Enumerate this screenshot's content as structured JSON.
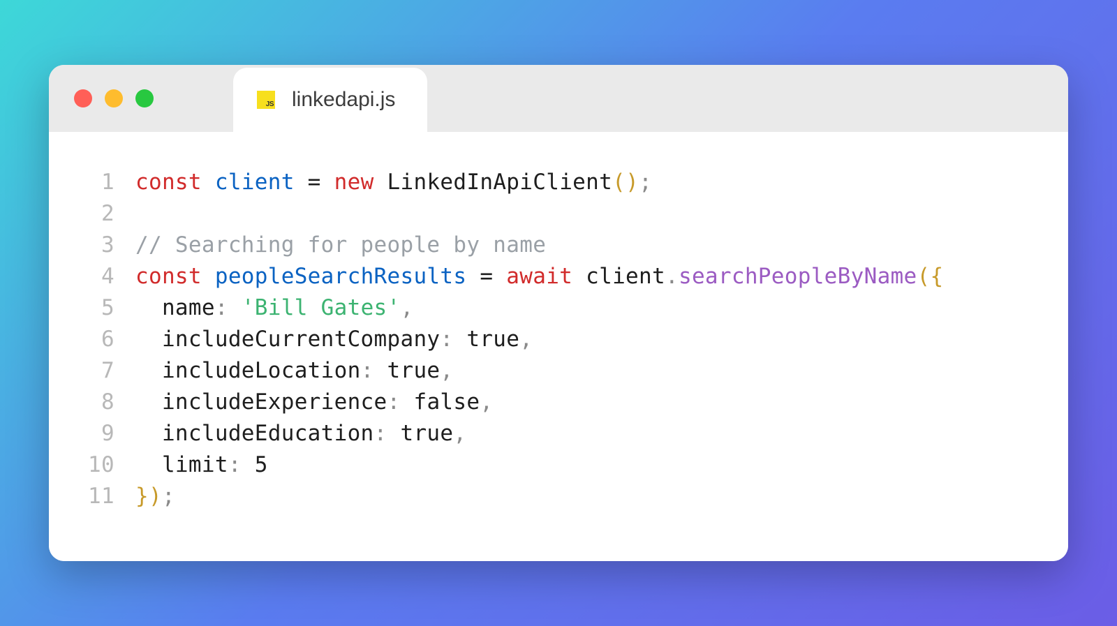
{
  "tab": {
    "filename": "linkedapi.js",
    "icon": "js-file"
  },
  "window_controls": {
    "close": "close",
    "minimize": "minimize",
    "maximize": "maximize"
  },
  "code": {
    "lines": {
      "1": {
        "number": "1",
        "tokens": {
          "const": "const",
          "var": "client",
          "eq": " = ",
          "new": "new",
          "class": "LinkedInApiClient",
          "lparen": "(",
          "rparen": ")",
          "semi": ";"
        }
      },
      "2": {
        "number": "2",
        "content": ""
      },
      "3": {
        "number": "3",
        "comment": "// Searching for people by name"
      },
      "4": {
        "number": "4",
        "tokens": {
          "const": "const",
          "var": "peopleSearchResults",
          "eq": " = ",
          "await": "await",
          "obj": "client",
          "dot": ".",
          "method": "searchPeopleByName",
          "lparen": "(",
          "lbrace": "{"
        }
      },
      "5": {
        "number": "5",
        "indent": "  ",
        "prop": "name",
        "colon": ": ",
        "value": "'Bill Gates'",
        "comma": ","
      },
      "6": {
        "number": "6",
        "indent": "  ",
        "prop": "includeCurrentCompany",
        "colon": ": ",
        "value": "true",
        "comma": ","
      },
      "7": {
        "number": "7",
        "indent": "  ",
        "prop": "includeLocation",
        "colon": ": ",
        "value": "true",
        "comma": ","
      },
      "8": {
        "number": "8",
        "indent": "  ",
        "prop": "includeExperience",
        "colon": ": ",
        "value": "false",
        "comma": ","
      },
      "9": {
        "number": "9",
        "indent": "  ",
        "prop": "includeEducation",
        "colon": ": ",
        "value": "true",
        "comma": ","
      },
      "10": {
        "number": "10",
        "indent": "  ",
        "prop": "limit",
        "colon": ": ",
        "value": "5"
      },
      "11": {
        "number": "11",
        "tokens": {
          "rbrace": "}",
          "rparen": ")",
          "semi": ";"
        }
      }
    }
  },
  "colors": {
    "keyword": "#d12b2b",
    "variable": "#0a62c2",
    "method": "#9b5bc2",
    "string": "#3cb371",
    "bracket": "#c79a2a",
    "comment": "#9aa0a6"
  }
}
